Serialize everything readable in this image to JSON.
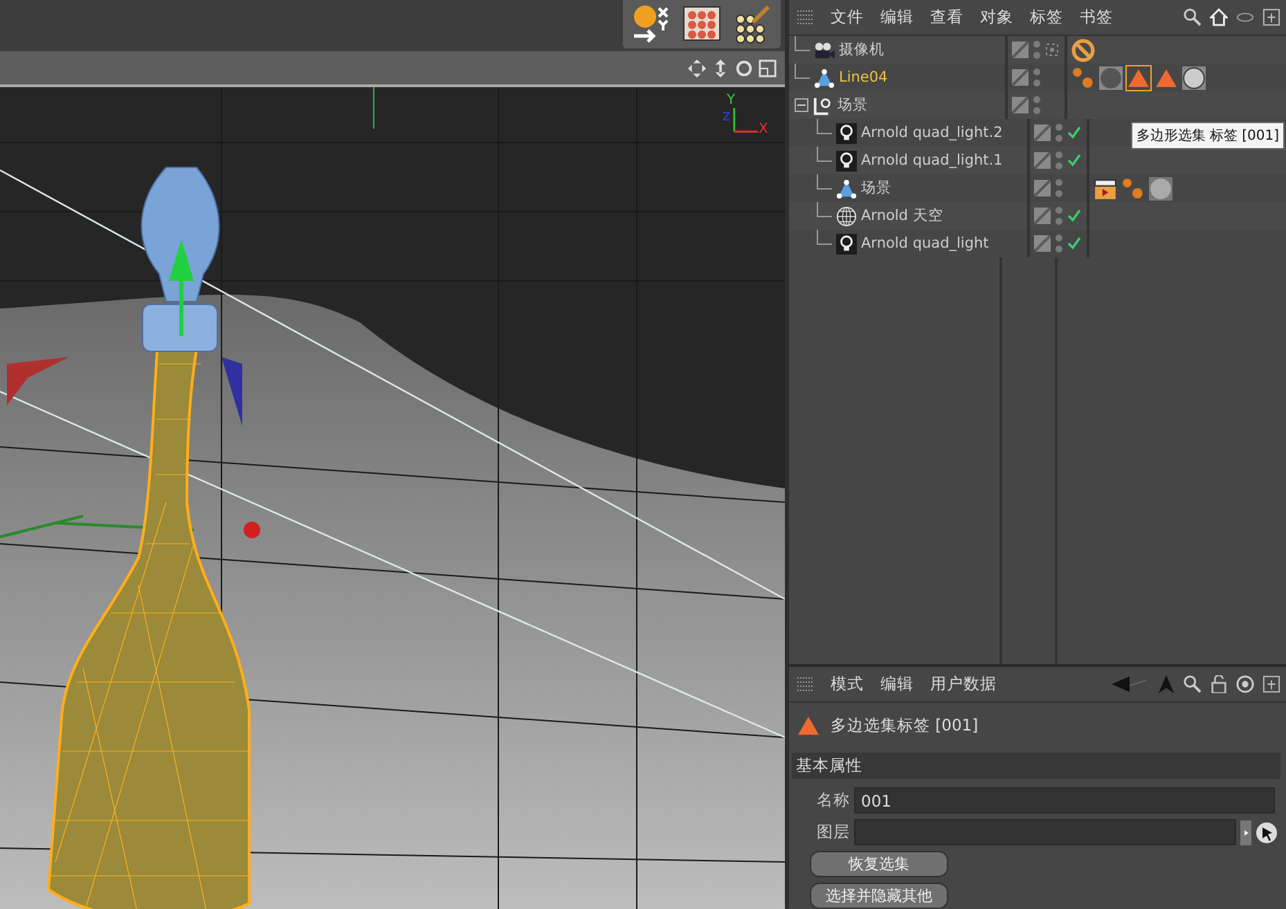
{
  "viewport": {
    "axis_labels": {
      "y": "Y",
      "z": "Z",
      "x": "X"
    }
  },
  "object_manager": {
    "menu": [
      "文件",
      "编辑",
      "查看",
      "对象",
      "标签",
      "书签"
    ],
    "tree": [
      {
        "name": "摄像机",
        "kind": "camera",
        "selected": false,
        "checked": false,
        "tags": [
          {
            "kind": "no-entry",
            "selected": false
          }
        ]
      },
      {
        "name": "Line04",
        "kind": "spline",
        "selected": true,
        "checked": false,
        "tags": [
          {
            "kind": "dots",
            "selected": false
          },
          {
            "kind": "sphere-dark",
            "selected": false
          },
          {
            "kind": "triangle",
            "selected": true
          },
          {
            "kind": "triangle",
            "selected": false
          },
          {
            "kind": "sphere-chrome",
            "selected": false
          }
        ]
      },
      {
        "name": "场景",
        "kind": "null",
        "selected": false,
        "checked": false,
        "expanded": true,
        "children": [
          {
            "name": "Arnold quad_light.2",
            "kind": "light",
            "selected": false,
            "checked": true
          },
          {
            "name": "Arnold quad_light.1",
            "kind": "light",
            "selected": false,
            "checked": true
          },
          {
            "name": "场景",
            "kind": "spline",
            "selected": false,
            "checked": false,
            "tags": [
              {
                "kind": "clapper",
                "selected": false
              },
              {
                "kind": "dots",
                "selected": false
              },
              {
                "kind": "sphere-grey",
                "selected": false
              }
            ]
          },
          {
            "name": "Arnold 天空",
            "kind": "sky",
            "selected": false,
            "checked": true
          },
          {
            "name": "Arnold quad_light",
            "kind": "light",
            "selected": false,
            "checked": true
          }
        ]
      }
    ],
    "tooltip": "多边形选集 标签 [001]"
  },
  "attributes": {
    "menu": [
      "模式",
      "编辑",
      "用户数据"
    ],
    "title": "多边选集标签 [001]",
    "section": "基本属性",
    "fields": [
      {
        "label": "名称",
        "value": "001",
        "kind": "text"
      },
      {
        "label": "图层",
        "kind": "link"
      }
    ],
    "buttons": [
      "恢复选集",
      "选择并隐藏其他"
    ]
  }
}
